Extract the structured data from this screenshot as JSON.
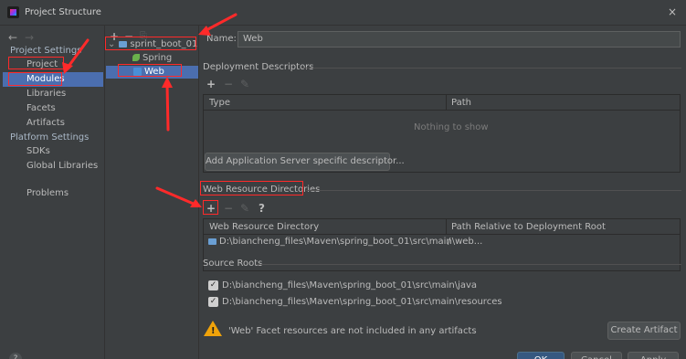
{
  "window": {
    "title": "Project Structure",
    "close_glyph": "×"
  },
  "left_nav": {
    "back_arrow": "←",
    "forward_arrow": "→",
    "project_settings": "Project Settings",
    "project_items": [
      "Project",
      "Modules",
      "Libraries",
      "Facets",
      "Artifacts"
    ],
    "platform_settings": "Platform Settings",
    "platform_items": [
      "SDKs",
      "Global Libraries"
    ],
    "problems": "Problems",
    "selected": "Modules"
  },
  "tree": {
    "add": "+",
    "remove": "−",
    "copy": "⎘",
    "chevron": "⌄",
    "root": "sprint_boot_01",
    "children": [
      "Spring",
      "Web"
    ],
    "selected": "Web"
  },
  "main": {
    "name_label": "Name:",
    "name_value": "Web",
    "deployment_title": "Deployment Descriptors",
    "dd_columns": [
      "Type",
      "Path"
    ],
    "dd_empty": "Nothing to show",
    "add_server_descriptor_btn": "Add Application Server specific descriptor...",
    "web_resource_title": "Web Resource Directories",
    "wr_columns": [
      "Web Resource Directory",
      "Path Relative to Deployment Root"
    ],
    "wr_rows": [
      {
        "dir": "D:\\biancheng_files\\Maven\\spring_boot_01\\src\\main\\web...",
        "path": "/"
      }
    ],
    "source_roots_title": "Source Roots",
    "source_roots": [
      "D:\\biancheng_files\\Maven\\spring_boot_01\\src\\main\\java",
      "D:\\biancheng_files\\Maven\\spring_boot_01\\src\\main\\resources"
    ],
    "warning_text": "'Web' Facet resources are not included in any artifacts",
    "create_artifact_btn": "Create Artifact",
    "toolbar": {
      "add": "+",
      "remove": "−",
      "edit": "✎",
      "help": "?"
    }
  },
  "footer": {
    "help": "?",
    "ok": "OK",
    "cancel": "Cancel",
    "apply": "Apply"
  },
  "colors": {
    "selection": "#4b6eaf",
    "annotation_red": "#ff2a2a",
    "background": "#3c3f41"
  }
}
